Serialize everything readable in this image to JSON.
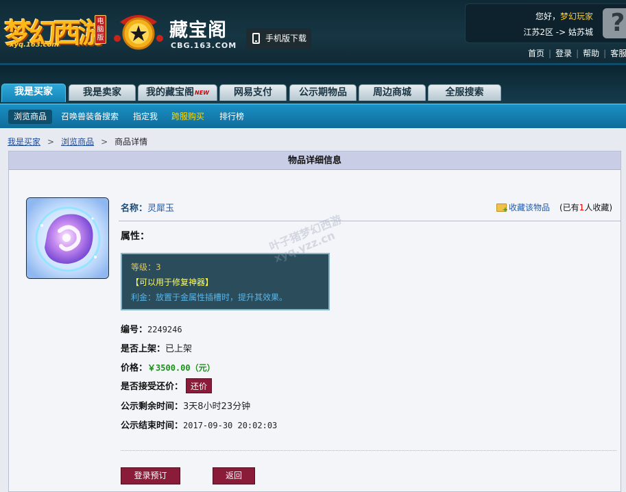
{
  "header": {
    "game_logo": {
      "text": "梦幻西游",
      "url": "xyq.163.com",
      "badge": "电脑版"
    },
    "cbg_logo": {
      "name": "藏宝阁",
      "url": "CBG.163.COM"
    },
    "mobile_download": "手机版下载",
    "user": {
      "greeting": "您好，",
      "username": "梦幻玩家",
      "server": "江苏2区 -> 姑苏城"
    },
    "top_links": [
      "首页",
      "登录",
      "帮助",
      "客服"
    ],
    "help_icon": "question-icon"
  },
  "nav": {
    "tabs": [
      {
        "label": "我是买家",
        "active": true
      },
      {
        "label": "我是卖家",
        "active": false
      },
      {
        "label": "我的藏宝阁",
        "badge": "NEW",
        "active": false
      },
      {
        "label": "网易支付",
        "active": false
      },
      {
        "label": "公示期物品",
        "active": false
      },
      {
        "label": "周边商城",
        "active": false
      },
      {
        "label": "全服搜索",
        "active": false
      }
    ],
    "subtabs": [
      {
        "label": "浏览商品",
        "active": true
      },
      {
        "label": "召唤兽装备搜索"
      },
      {
        "label": "指定我"
      },
      {
        "label": "跨服购买",
        "highlight": true
      },
      {
        "label": "排行榜"
      }
    ]
  },
  "breadcrumb": {
    "items": [
      "我是买家",
      "浏览商品"
    ],
    "current": "商品详情"
  },
  "panel": {
    "title": "物品详细信息",
    "item": {
      "name_label": "名称：",
      "name": "灵犀玉",
      "favorite_label": "收藏该物品",
      "favorite_prefix": "(已有",
      "favorite_count": "1",
      "favorite_suffix": "人收藏)",
      "attr_label": "属性：",
      "attributes": {
        "line1": "等级：3",
        "line2": "【可以用于修复神器】",
        "line3": "利金：放置于金属性插槽时，提升其效果。"
      },
      "watermark": [
        "叶子猪梦幻西游",
        "xyq.yzz.cn"
      ],
      "fields": {
        "id_label": "编号：",
        "id_value": "2249246",
        "listed_label": "是否上架：",
        "listed_value": "已上架",
        "price_label": "价格：",
        "price_value": "￥3500.00（元）",
        "counter_label": "是否接受还价：",
        "counter_button": "还价",
        "remaining_label": "公示剩余时间：",
        "remaining_value": "3天8小时23分钟",
        "end_label": "公示结束时间：",
        "end_value": "2017-09-30 20:02:03"
      }
    },
    "buttons": {
      "reserve": "登录预订",
      "back": "返回"
    }
  },
  "colors": {
    "accent_blue": "#1383b8",
    "price_green": "#1a8f1a",
    "button_maroon": "#8a1c3a"
  }
}
